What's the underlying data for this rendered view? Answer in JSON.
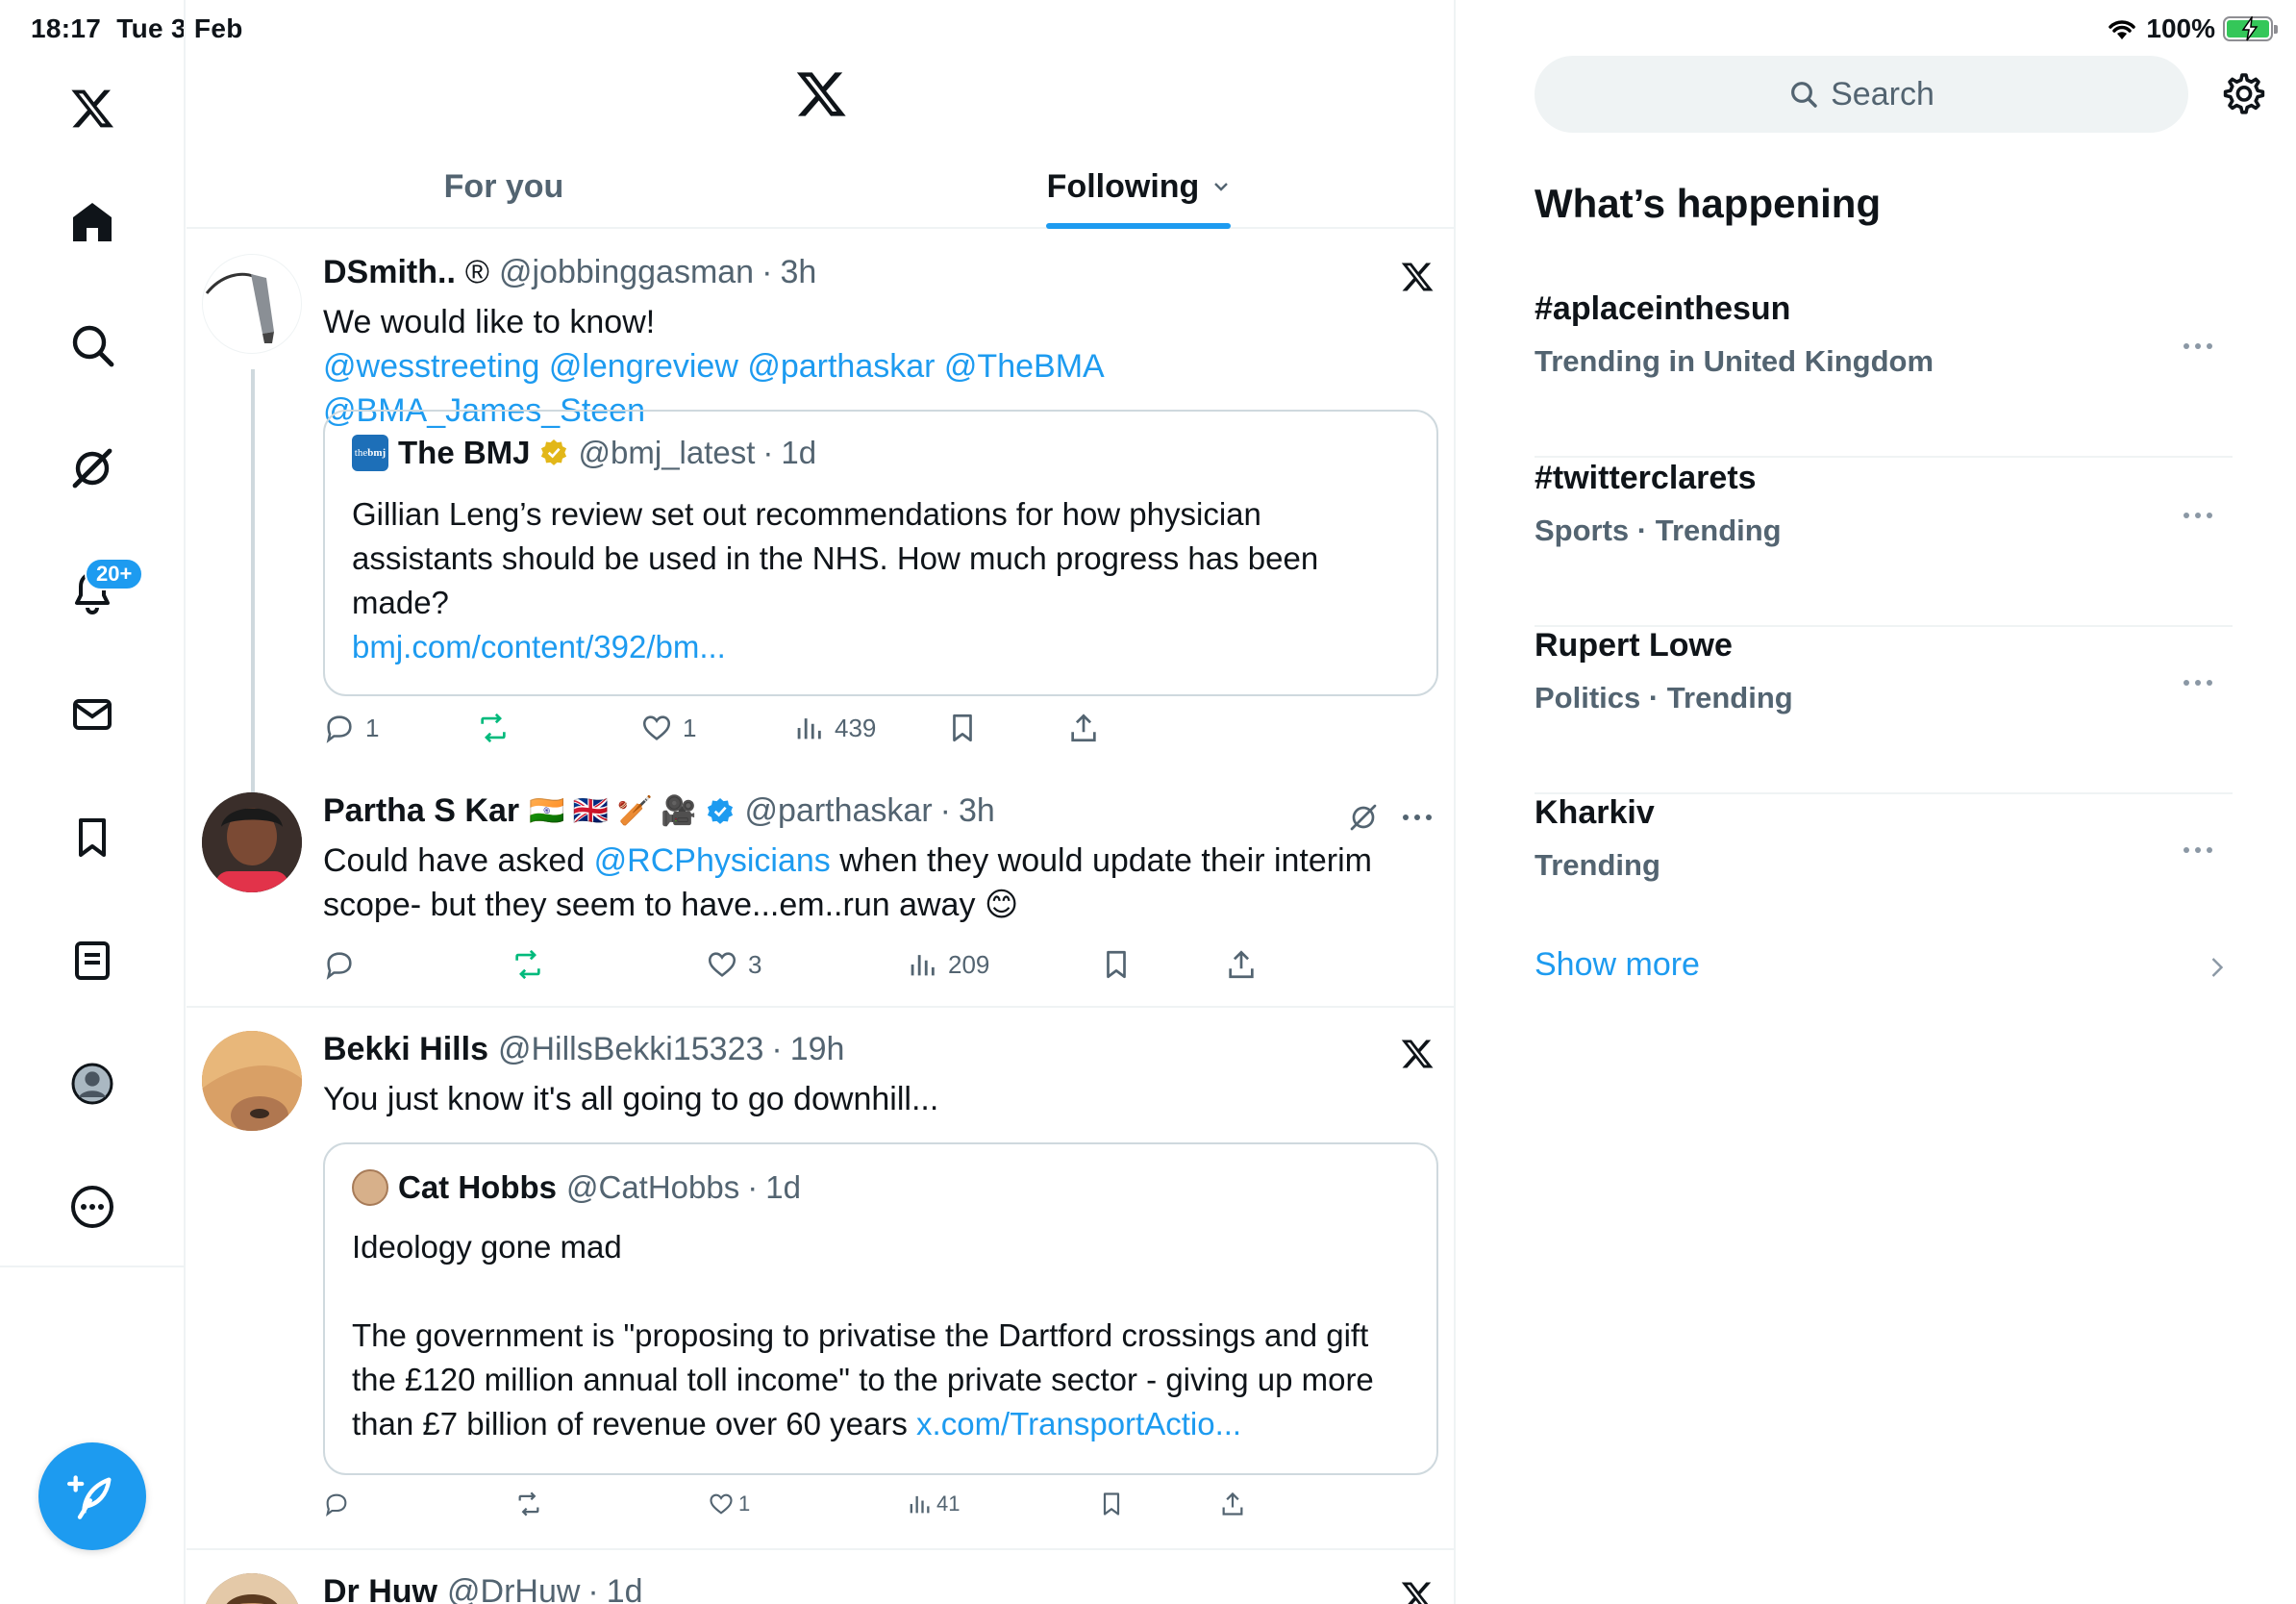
{
  "status_bar": {
    "time": "18:17",
    "date": "Tue 3 Feb",
    "battery": "100%"
  },
  "tabs": [
    {
      "label": "For you",
      "active": false
    },
    {
      "label": "Following",
      "active": true
    }
  ],
  "nav": {
    "notifications_badge": "20+",
    "items": [
      "x-logo-icon",
      "home-icon",
      "search-icon",
      "grok-icon",
      "notifications-icon",
      "messages-icon",
      "bookmarks-icon",
      "lists-icon",
      "profile-icon",
      "more-icon"
    ]
  },
  "posts": [
    {
      "name": "DSmith..",
      "badge": "®",
      "handle": "@jobbinggasman",
      "time": "3h",
      "text": "We would like to know!",
      "mentions": "@wesstreeting @lengreview @parthaskar @TheBMA @BMA_James_Steen",
      "quote": {
        "name": "The BMJ",
        "handle": "@bmj_latest",
        "time": "1d",
        "text": "Gillian Leng’s review set out recommendations for how physician assistants should be used in the NHS. How much progress has been made?",
        "link": "bmj.com/content/392/bm..."
      },
      "replies": "1",
      "likes": "1",
      "views": "439"
    },
    {
      "name": "Partha S Kar",
      "emoji": "🇮🇳 🇬🇧 🏏 🎥",
      "handle": "@parthaskar",
      "time": "3h",
      "text_before": "Could have asked ",
      "mention": "@RCPhysicians",
      "text_after": " when they would update their interim scope- but they seem to have...em..run away 😊",
      "likes": "3",
      "views": "209"
    },
    {
      "name": "Bekki Hills",
      "handle": "@HillsBekki15323",
      "time": "19h",
      "text": "You just know it's all going to go downhill...",
      "quote": {
        "name": "Cat Hobbs",
        "handle": "@CatHobbs",
        "time": "1d",
        "text1": "Ideology gone mad",
        "text2": "The government is \"proposing to privatise the Dartford crossings and gift the £120 million annual toll income\" to the private sector - giving up more than £7 billion of revenue over 60 years ",
        "link": "x.com/TransportActio..."
      },
      "likes": "1",
      "views": "41"
    },
    {
      "name": "Dr Huw",
      "handle": "@DrHuw",
      "time": "1d"
    }
  ],
  "sidebar": {
    "search_placeholder": "Search",
    "title": "What’s happening",
    "trends": [
      {
        "name": "#aplaceinthesun",
        "context": "Trending in United Kingdom"
      },
      {
        "name": "#twitterclarets",
        "context": "Sports · Trending"
      },
      {
        "name": "Rupert Lowe",
        "context": "Politics · Trending"
      },
      {
        "name": "Kharkiv",
        "context": "Trending"
      }
    ],
    "show_more": "Show more"
  },
  "colors": {
    "accent": "#1d9bf0",
    "retweet": "#00ba7c",
    "text": "#0f1419",
    "muted": "#536471"
  }
}
